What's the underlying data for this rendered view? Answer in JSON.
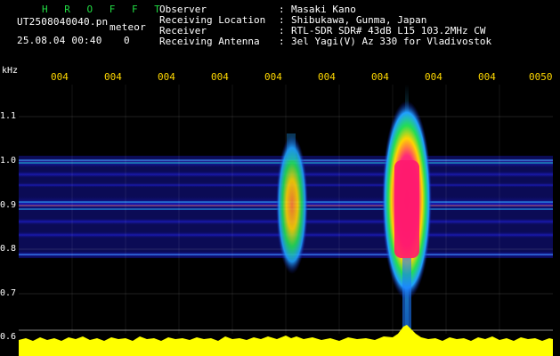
{
  "header": {
    "brand": "H R O F F T",
    "filename": "UT2508040040.pn",
    "meteor_label": "meteor",
    "datetime": "25.08.04 00:40",
    "count": "0",
    "meta": [
      {
        "label": "Observer",
        "value": "Masaki Kano"
      },
      {
        "label": "Receiving Location",
        "value": "Shibukawa, Gunma, Japan"
      },
      {
        "label": "Receiver",
        "value": "RTL-SDR SDR# 43dB L15 103.2MHz CW"
      },
      {
        "label": "Receiving Antenna",
        "value": "3el Yagi(V) Az 330 for Vladivostok"
      }
    ]
  },
  "y_axis": {
    "unit": "kHz",
    "labels": [
      "1.1",
      "1.0",
      "0.9",
      "0.8",
      "0.7",
      "0.6"
    ]
  },
  "time_axis": {
    "labels": [
      "004",
      "004",
      "004",
      "004",
      "004",
      "004",
      "004",
      "004",
      "004",
      "0050"
    ]
  },
  "colors": {
    "background": "#000000",
    "brand_text": "#22dd44",
    "time_labels": "#ffd800",
    "grid": "#ffffff",
    "noise_floor": "#ffff00",
    "echo_core": "#ff1a6e"
  }
}
